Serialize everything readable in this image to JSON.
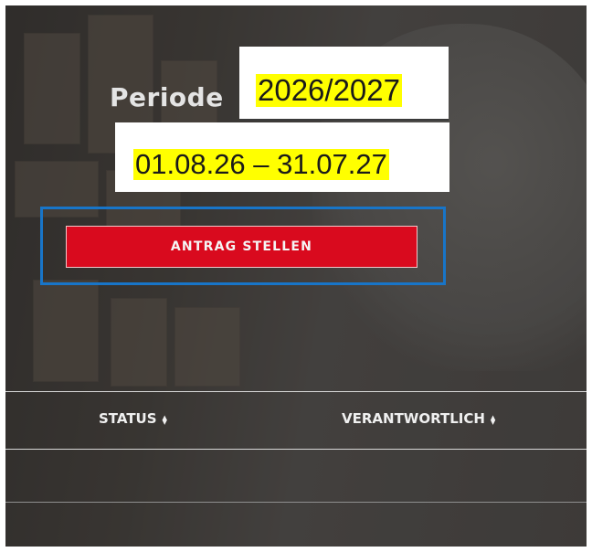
{
  "period": {
    "label": "Periode",
    "year": "2026/2027",
    "dates": "01.08.26 – 31.07.27"
  },
  "actions": {
    "apply_label": "ANTRAG STELLEN"
  },
  "table": {
    "columns": [
      {
        "label": "STATUS",
        "sort_icon": "sort-icon"
      },
      {
        "label": "VERANTWORTLICH",
        "sort_icon": "sort-icon"
      }
    ]
  },
  "colors": {
    "accent_button": "#d90a1e",
    "annotation_highlight": "#ffff00",
    "annotation_frame": "#1875c8"
  }
}
